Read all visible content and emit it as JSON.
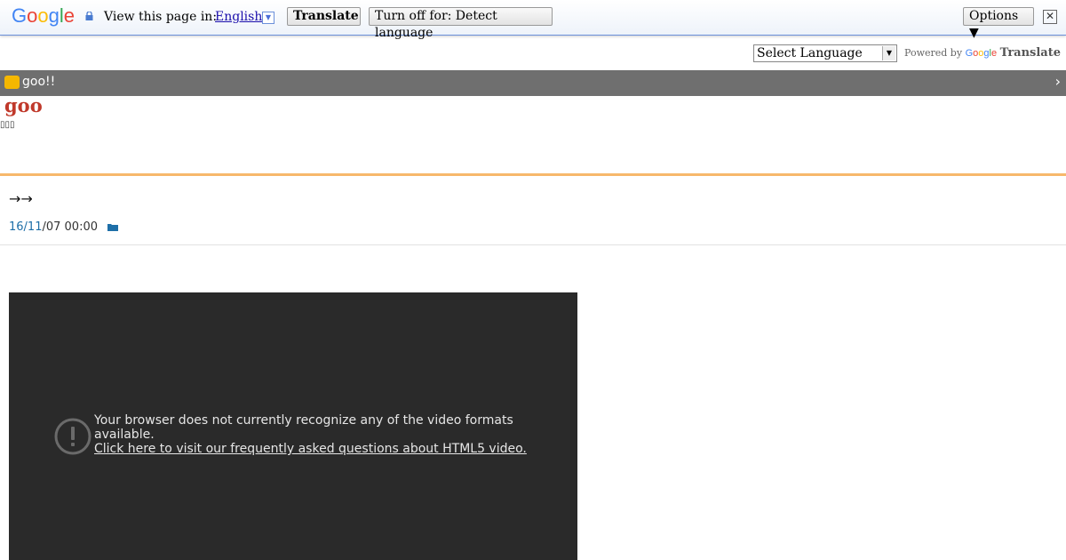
{
  "translate_bar": {
    "logo_text": "Google",
    "view_label": "View this page in:",
    "language": "English",
    "translate_button": "Translate",
    "turn_off_button": "Turn off for: Detect language",
    "options_button": "Options ▼",
    "close_glyph": "✕"
  },
  "language_widget": {
    "select_value": "Select Language",
    "powered_by": "Powered by",
    "powered_google": "Google",
    "powered_translate": "Translate"
  },
  "site_bar": {
    "name": "goo!!",
    "chevron": "›"
  },
  "blog": {
    "logo": "goo",
    "subtitle_glyphs": "▯▯▯"
  },
  "post": {
    "title": "→→",
    "date_part_a": "16/11",
    "date_part_b": "/07 00:00"
  },
  "video": {
    "message": "Your browser does not currently recognize any of the video formats available.",
    "link_text": "Click here to visit our frequently asked questions about HTML5 video."
  },
  "colors": {
    "site_bar": "#6f6f6f",
    "accent_line": "#f7b86b",
    "logo_red": "#c0392b",
    "link_blue": "#1e6fa8",
    "video_bg": "#2a2a2a"
  }
}
